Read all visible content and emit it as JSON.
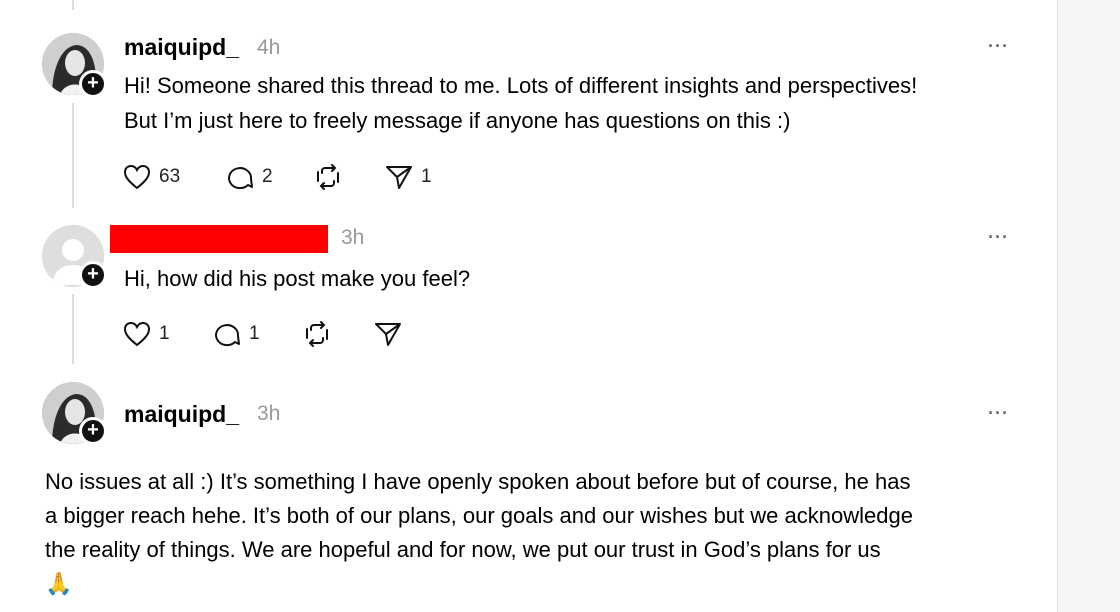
{
  "posts": [
    {
      "username": "maiquipd_",
      "time": "4h",
      "more": "···",
      "text_lines": [
        "Hi! Someone shared this thread to me. Lots of different insights and perspectives!",
        "But I’m just here to freely message if anyone has questions on this :)"
      ],
      "likes": "63",
      "replies": "2",
      "shares": "1"
    },
    {
      "username": "",
      "time": "3h",
      "more": "···",
      "text_lines": [
        "Hi, how did his post make you feel?"
      ],
      "likes": "1",
      "replies": "1"
    },
    {
      "username": "maiquipd_",
      "time": "3h",
      "more": "···",
      "text_lines": [
        "No issues at all :) It’s something I have openly spoken about before but of course, he has",
        "a bigger reach hehe. It’s both of our plans, our goals and our wishes but we acknowledge",
        "the reality of things. We are hopeful and for now, we put our trust in God’s plans for us",
        "🙏"
      ]
    }
  ],
  "icons": {
    "like": "heart-icon",
    "reply": "comment-icon",
    "repost": "repost-icon",
    "share": "send-icon",
    "follow": "plus-icon",
    "more": "more-icon"
  },
  "colors": {
    "background": "#ffffff",
    "muted": "#999999",
    "redaction": "#ff0000",
    "thread_line": "#dcdcdc"
  }
}
